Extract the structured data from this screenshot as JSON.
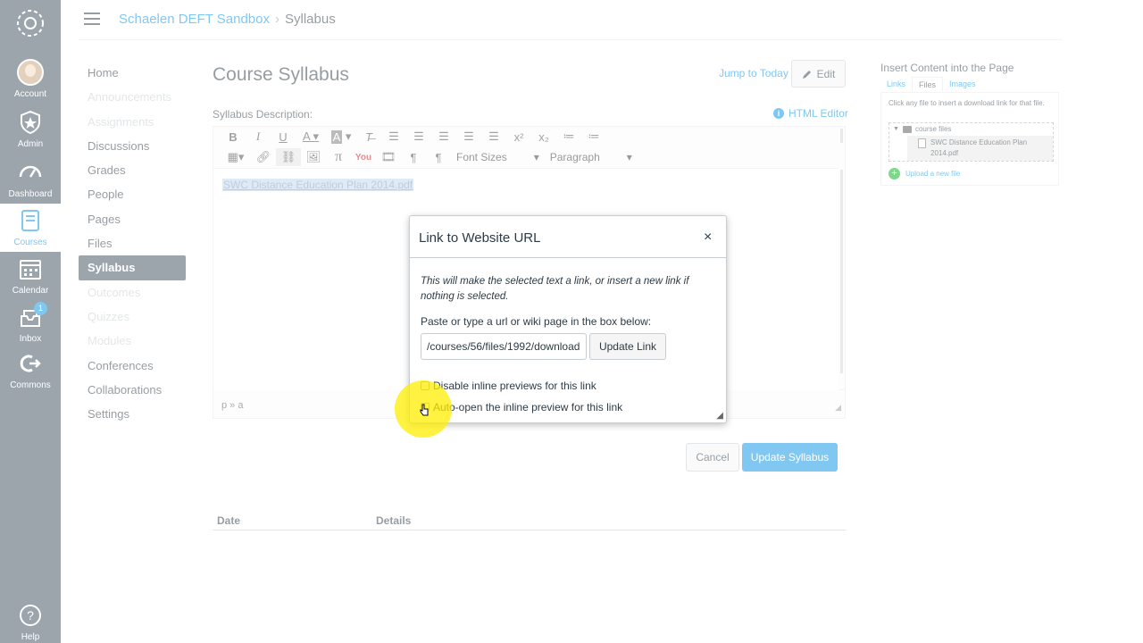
{
  "global_nav": {
    "items": [
      {
        "label": "Account",
        "icon": "avatar"
      },
      {
        "label": "Admin",
        "icon": "shield-star-icon"
      },
      {
        "label": "Dashboard",
        "icon": "dashboard-icon"
      },
      {
        "label": "Courses",
        "icon": "book-icon",
        "active": true
      },
      {
        "label": "Calendar",
        "icon": "calendar-icon"
      },
      {
        "label": "Inbox",
        "icon": "inbox-icon",
        "badge": "1"
      },
      {
        "label": "Commons",
        "icon": "commons-icon"
      },
      {
        "label": "Help",
        "icon": "help-icon"
      }
    ]
  },
  "breadcrumb": {
    "course": "Schaelen DEFT Sandbox",
    "separator": "›",
    "current": "Syllabus"
  },
  "course_nav": [
    {
      "label": "Home"
    },
    {
      "label": "Announcements",
      "disabled": true
    },
    {
      "label": "Assignments",
      "disabled": true
    },
    {
      "label": "Discussions"
    },
    {
      "label": "Grades"
    },
    {
      "label": "People"
    },
    {
      "label": "Pages"
    },
    {
      "label": "Files"
    },
    {
      "label": "Syllabus",
      "active": true
    },
    {
      "label": "Outcomes",
      "disabled": true
    },
    {
      "label": "Quizzes",
      "disabled": true
    },
    {
      "label": "Modules",
      "disabled": true
    },
    {
      "label": "Conferences"
    },
    {
      "label": "Collaborations"
    },
    {
      "label": "Settings"
    }
  ],
  "main": {
    "title": "Course Syllabus",
    "jump_link": "Jump to Today",
    "edit_label": "Edit",
    "description_label": "Syllabus Description:",
    "html_editor_link": "HTML Editor",
    "editor": {
      "font_sizes_label": "Font Sizes",
      "paragraph_label": "Paragraph",
      "content_link": "SWC Distance Education Plan 2014.pdf",
      "status_path": "p » a"
    },
    "cancel_label": "Cancel",
    "update_label": "Update Syllabus",
    "table_headers": [
      "Date",
      "Details"
    ]
  },
  "sidebar": {
    "title": "Insert Content into the Page",
    "tabs": [
      "Links",
      "Files",
      "Images"
    ],
    "active_tab": "Files",
    "hint": "Click any file to insert a download link for that file.",
    "folder": "course files",
    "file": "SWC Distance Education Plan 2014.pdf",
    "upload": "Upload a new file"
  },
  "modal": {
    "title": "Link to Website URL",
    "close": "×",
    "description": "This will make the selected text a link, or insert a new link if nothing is selected.",
    "prompt": "Paste or type a url or wiki page in the box below:",
    "url_value": "/courses/56/files/1992/download",
    "update_link_label": "Update Link",
    "option_disable_previews": "Disable inline previews for this link",
    "option_auto_open": "Auto-open the inline preview for this link"
  },
  "colors": {
    "nav_bg": "#394b58",
    "accent": "#008ee2",
    "highlight": "#ffee00"
  }
}
